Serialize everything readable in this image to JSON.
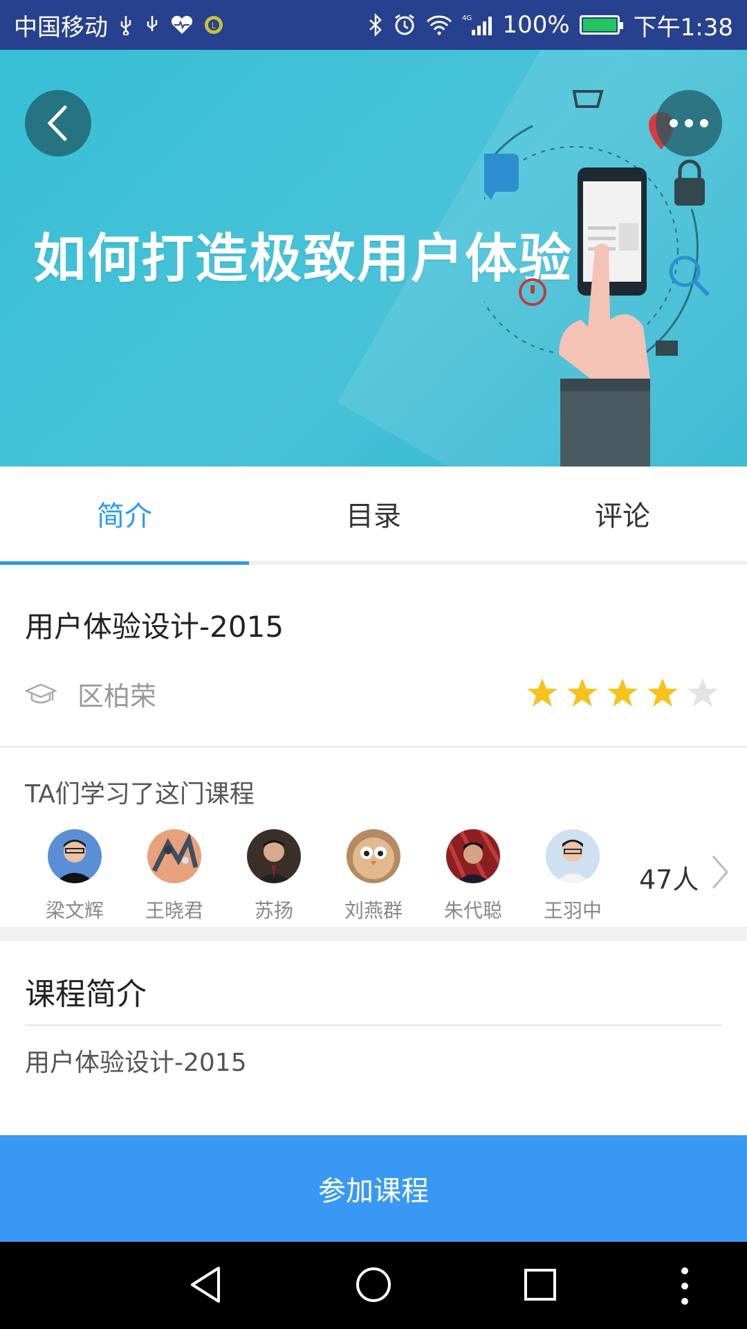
{
  "status_bar": {
    "carrier": "中国移动",
    "network": "4G",
    "battery": "100%",
    "time": "下午1:38"
  },
  "hero": {
    "title": "如何打造极致用户体验",
    "back_icon": "back-arrow-icon",
    "more_icon": "more-dots-icon"
  },
  "tabs": [
    {
      "label": "简介",
      "active": true
    },
    {
      "label": "目录",
      "active": false
    },
    {
      "label": "评论",
      "active": false
    }
  ],
  "course": {
    "title": "用户体验设计-2015",
    "teacher": "区柏荣",
    "teacher_icon": "graduation-cap-icon",
    "rating": 4,
    "rating_max": 5,
    "star_color": "#f7c21b"
  },
  "learners": {
    "heading": "TA们学习了这门课程",
    "people": [
      {
        "name": "梁文辉"
      },
      {
        "name": "王晓君"
      },
      {
        "name": "苏扬"
      },
      {
        "name": "刘燕群"
      },
      {
        "name": "朱代聪"
      },
      {
        "name": "王羽中"
      }
    ],
    "count": "47人"
  },
  "intro": {
    "heading": "课程简介",
    "text": "用户体验设计-2015"
  },
  "join_button": {
    "label": "参加课程",
    "color": "#3a98f5"
  },
  "accent_color": "#2a9af3"
}
